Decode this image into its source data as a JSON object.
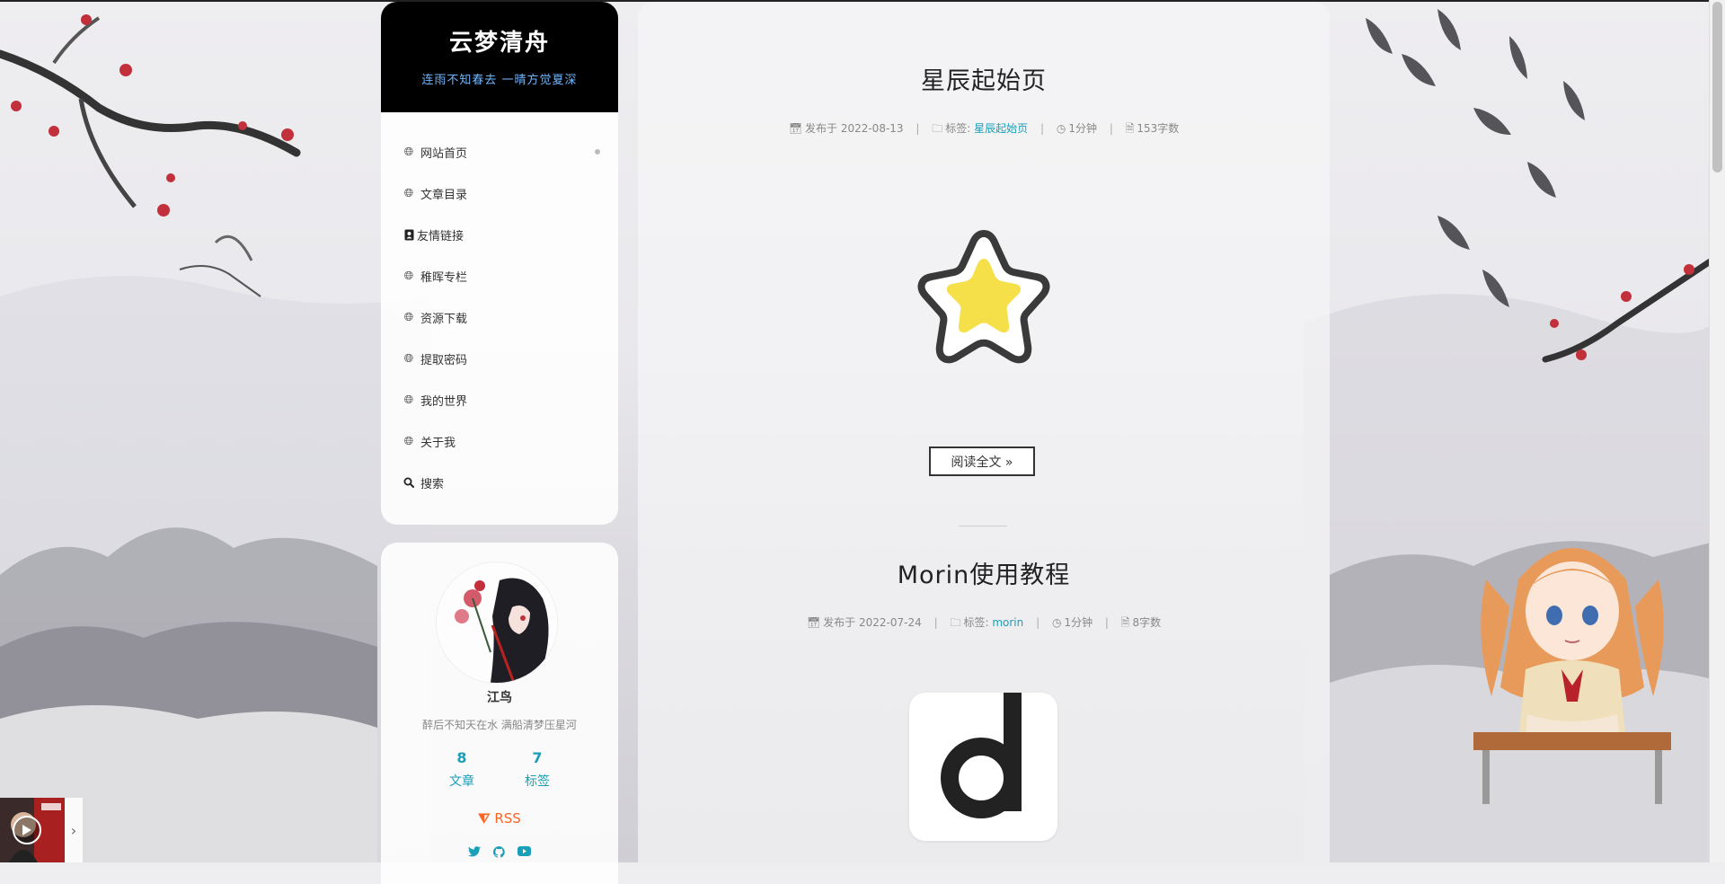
{
  "site": {
    "title": "云梦清舟",
    "subtitle": "连雨不知春去 一晴方觉夏深"
  },
  "menu": {
    "items": [
      {
        "label": "网站首页",
        "icon": "globe-icon"
      },
      {
        "label": "文章目录",
        "icon": "globe-icon"
      },
      {
        "label": "友情链接",
        "icon": "address-book-icon"
      },
      {
        "label": "稚晖专栏",
        "icon": "globe-icon"
      },
      {
        "label": "资源下载",
        "icon": "globe-icon"
      },
      {
        "label": "提取密码",
        "icon": "globe-icon"
      },
      {
        "label": "我的世界",
        "icon": "globe-icon"
      },
      {
        "label": "关于我",
        "icon": "globe-icon"
      },
      {
        "label": "搜索",
        "icon": "search-icon"
      }
    ]
  },
  "profile": {
    "name": "江鸟",
    "motto": "醉后不知天在水 满船清梦压星河",
    "stats": [
      {
        "num": "8",
        "label": "文章"
      },
      {
        "num": "7",
        "label": "标签"
      }
    ],
    "rss_label": "RSS",
    "socials": [
      "twitter-icon",
      "github-icon",
      "youtube-icon"
    ]
  },
  "posts": [
    {
      "title": "星辰起始页",
      "published_label": "发布于",
      "date": "2022-08-13",
      "tags_label": "标签:",
      "tag": "星辰起始页",
      "read_time": "1分钟",
      "word_count": "153字数",
      "read_more": "阅读全文 »"
    },
    {
      "title": "Morin使用教程",
      "published_label": "发布于",
      "date": "2022-07-24",
      "tags_label": "标签:",
      "tag": "morin",
      "read_time": "1分钟",
      "word_count": "8字数"
    }
  ],
  "colors": {
    "accent": "#1a9fb8",
    "header_bg": "#000000",
    "subtitle": "#6fb6ff",
    "rss": "#fc6423",
    "star_fill": "#f5e04a",
    "star_outline": "#3a3a3a"
  }
}
